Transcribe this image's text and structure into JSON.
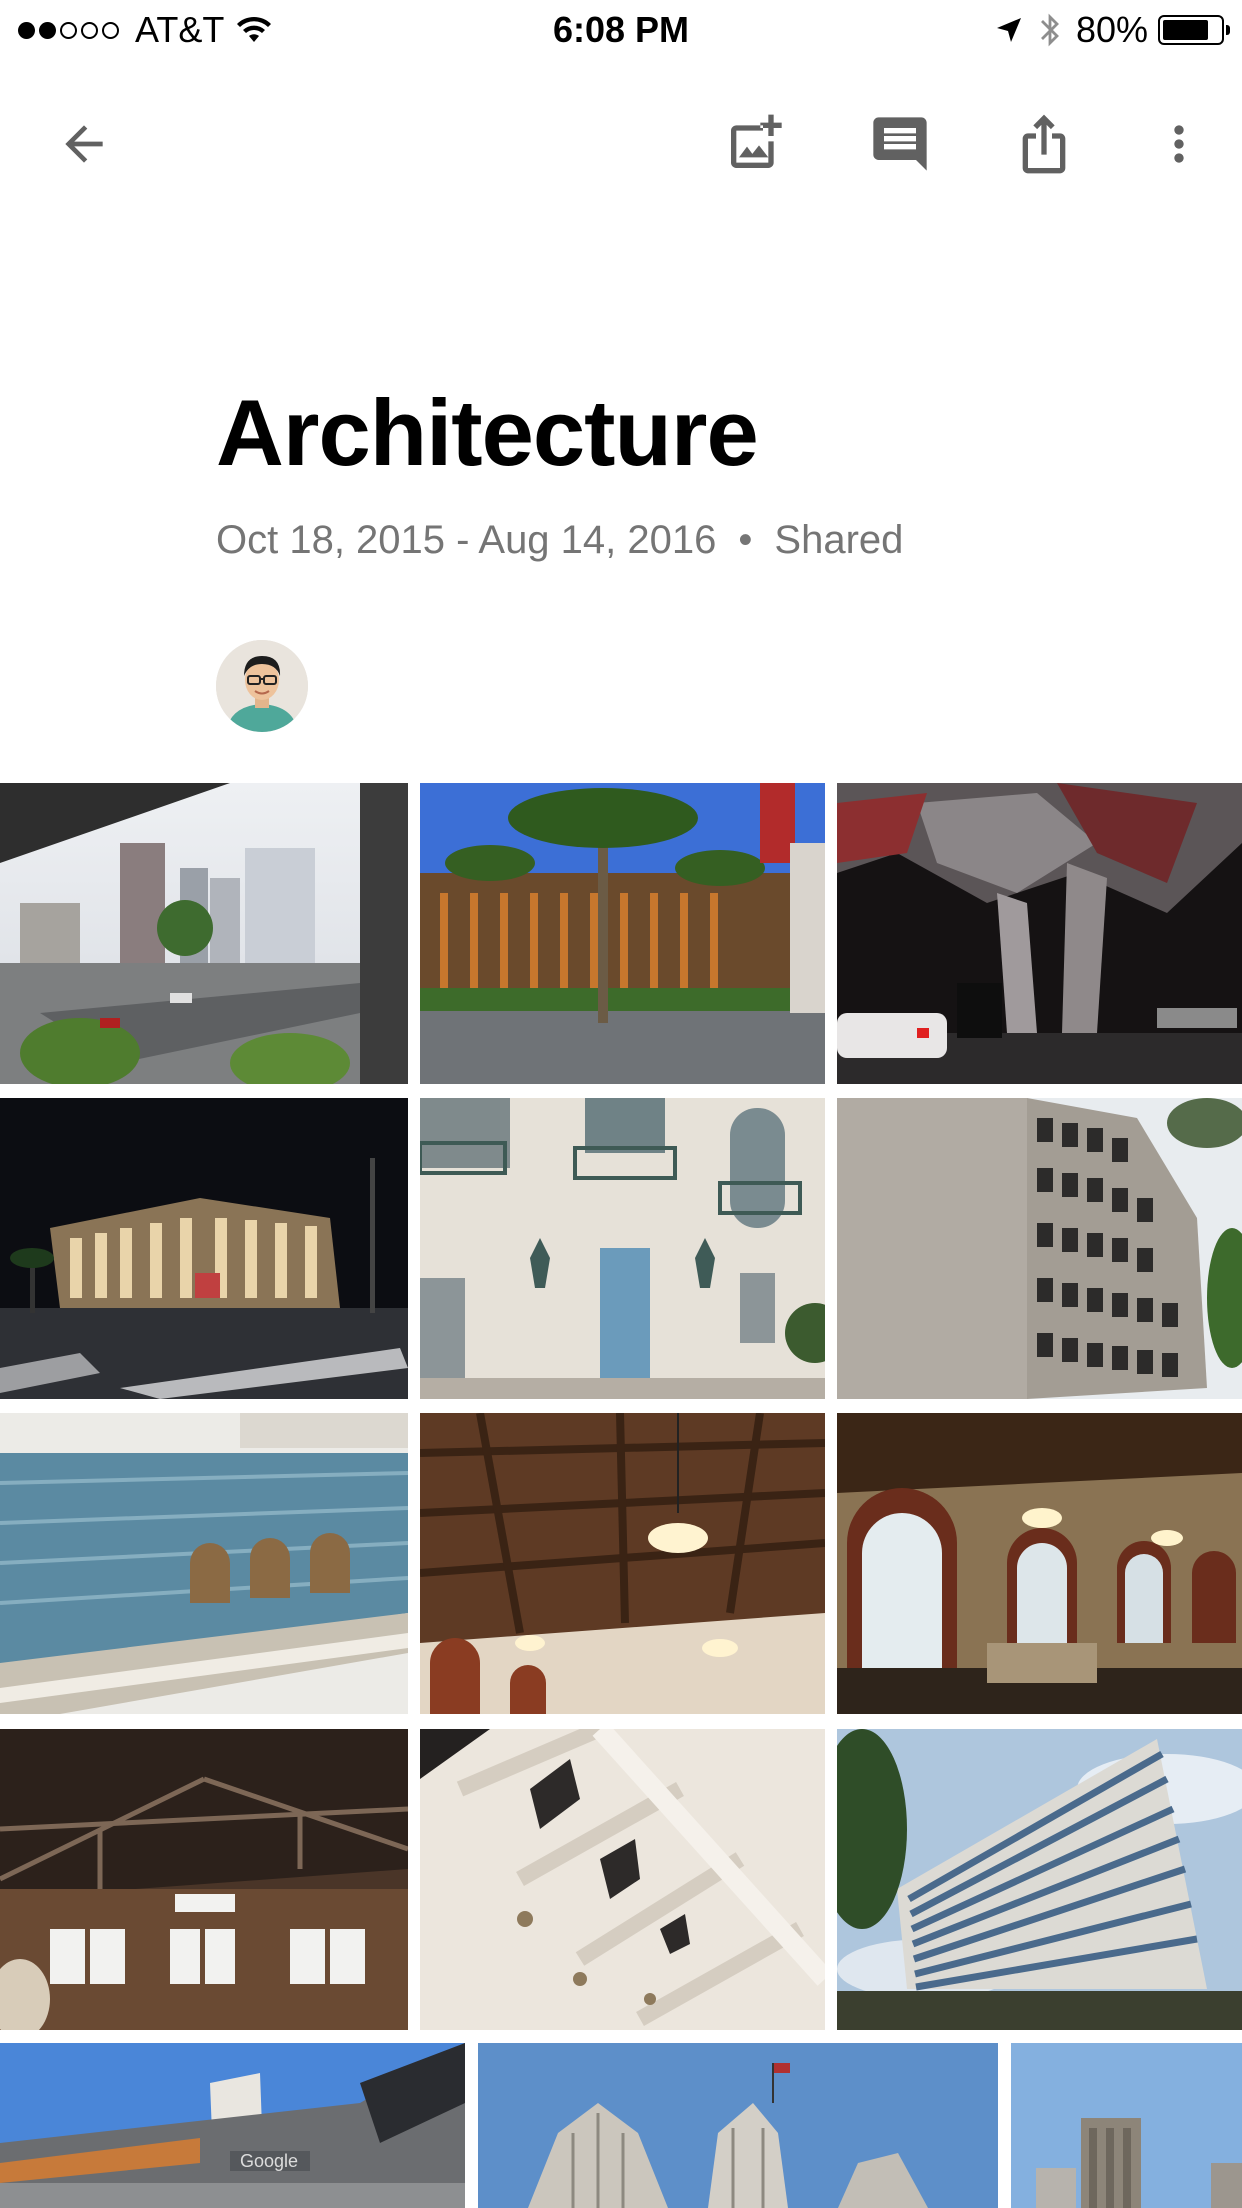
{
  "status_bar": {
    "carrier": "AT&T",
    "signal_bars": 2,
    "time": "6:08 PM",
    "battery_percent": "80%",
    "battery_level": 0.8
  },
  "toolbar": {
    "back_icon": "arrow-back-icon",
    "add_photo_icon": "add-photo-icon",
    "comment_icon": "comment-icon",
    "share_icon": "share-icon",
    "more_icon": "more-vert-icon"
  },
  "album": {
    "title": "Architecture",
    "date_range": "Oct 18, 2015 - Aug 14, 2016",
    "separator": "•",
    "shared_label": "Shared"
  },
  "photos": [
    {
      "name": "photo-city-street-aerial"
    },
    {
      "name": "photo-palm-tree-building"
    },
    {
      "name": "photo-angular-canopy-night"
    },
    {
      "name": "photo-lit-glass-building-night"
    },
    {
      "name": "photo-ornate-facade-balconies"
    },
    {
      "name": "photo-concrete-grid-building"
    },
    {
      "name": "photo-museum-blue-wall-arches"
    },
    {
      "name": "photo-wooden-ceiling-chandeliers"
    },
    {
      "name": "photo-hall-arched-windows"
    },
    {
      "name": "photo-truss-roof-hall"
    },
    {
      "name": "photo-white-beam-ceiling"
    },
    {
      "name": "photo-office-tower-sky"
    },
    {
      "name": "photo-google-sign-building"
    },
    {
      "name": "photo-art-deco-tower"
    },
    {
      "name": "photo-downtown-skyline"
    }
  ],
  "colors": {
    "icon_gray": "#616161",
    "meta_gray": "#757575"
  }
}
